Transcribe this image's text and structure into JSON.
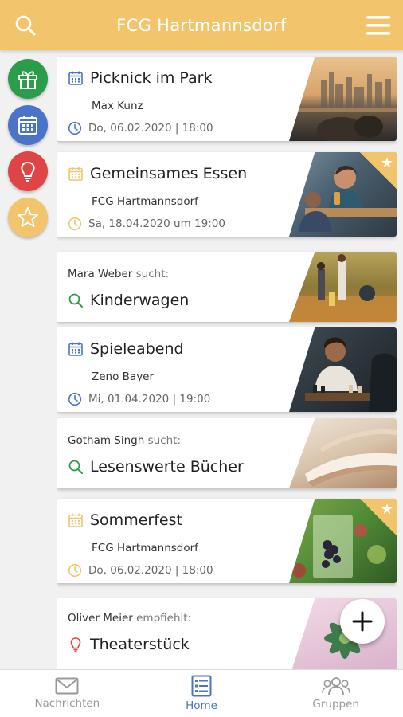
{
  "header": {
    "title": "FCG Hartmannsdorf",
    "search_icon": "search-icon",
    "menu_icon": "menu-icon",
    "color": "#f2c46b"
  },
  "rail": [
    {
      "name": "gift-icon",
      "color": "#2a9d4a"
    },
    {
      "name": "calendar-icon",
      "color": "#4a74c9"
    },
    {
      "name": "lightbulb-icon",
      "color": "#e04545"
    },
    {
      "name": "star-icon",
      "color": "#f2c46b"
    }
  ],
  "cards": [
    {
      "kind": "event",
      "title": "Picknick im Park",
      "subtitle": "Max Kunz",
      "date": "Do, 06.02.2020 | 18:00",
      "icon_color": "#4a74c9",
      "starred": false
    },
    {
      "kind": "event",
      "title": "Gemeinsames Essen",
      "subtitle": "FCG Hartmannsdorf",
      "date": "Sa, 18.04.2020 um 19:00",
      "icon_color": "#f2c46b",
      "starred": true
    },
    {
      "kind": "search",
      "person": "Mara Weber",
      "verb": "sucht:",
      "title": "Kinderwagen"
    },
    {
      "kind": "event",
      "title": "Spieleabend",
      "subtitle": "Zeno Bayer",
      "date": "Mi, 01.04.2020 | 19:00",
      "icon_color": "#4a74c9",
      "starred": false
    },
    {
      "kind": "search",
      "person": "Gotham Singh",
      "verb": "sucht:",
      "title": "Lesenswerte Bücher"
    },
    {
      "kind": "event",
      "title": "Sommerfest",
      "subtitle": "FCG Hartmannsdorf",
      "date": "Do, 06.02.2020 | 18:00",
      "icon_color": "#f2c46b",
      "starred": true
    },
    {
      "kind": "recommend",
      "person": "Oliver Meier",
      "verb": "empfiehlt:",
      "title": "Theaterstück"
    }
  ],
  "fab": {
    "icon": "plus-icon"
  },
  "nav": [
    {
      "label": "Nachrichten",
      "icon": "envelope-icon",
      "active": false
    },
    {
      "label": "Home",
      "icon": "list-icon",
      "active": true
    },
    {
      "label": "Gruppen",
      "icon": "people-icon",
      "active": false
    }
  ]
}
